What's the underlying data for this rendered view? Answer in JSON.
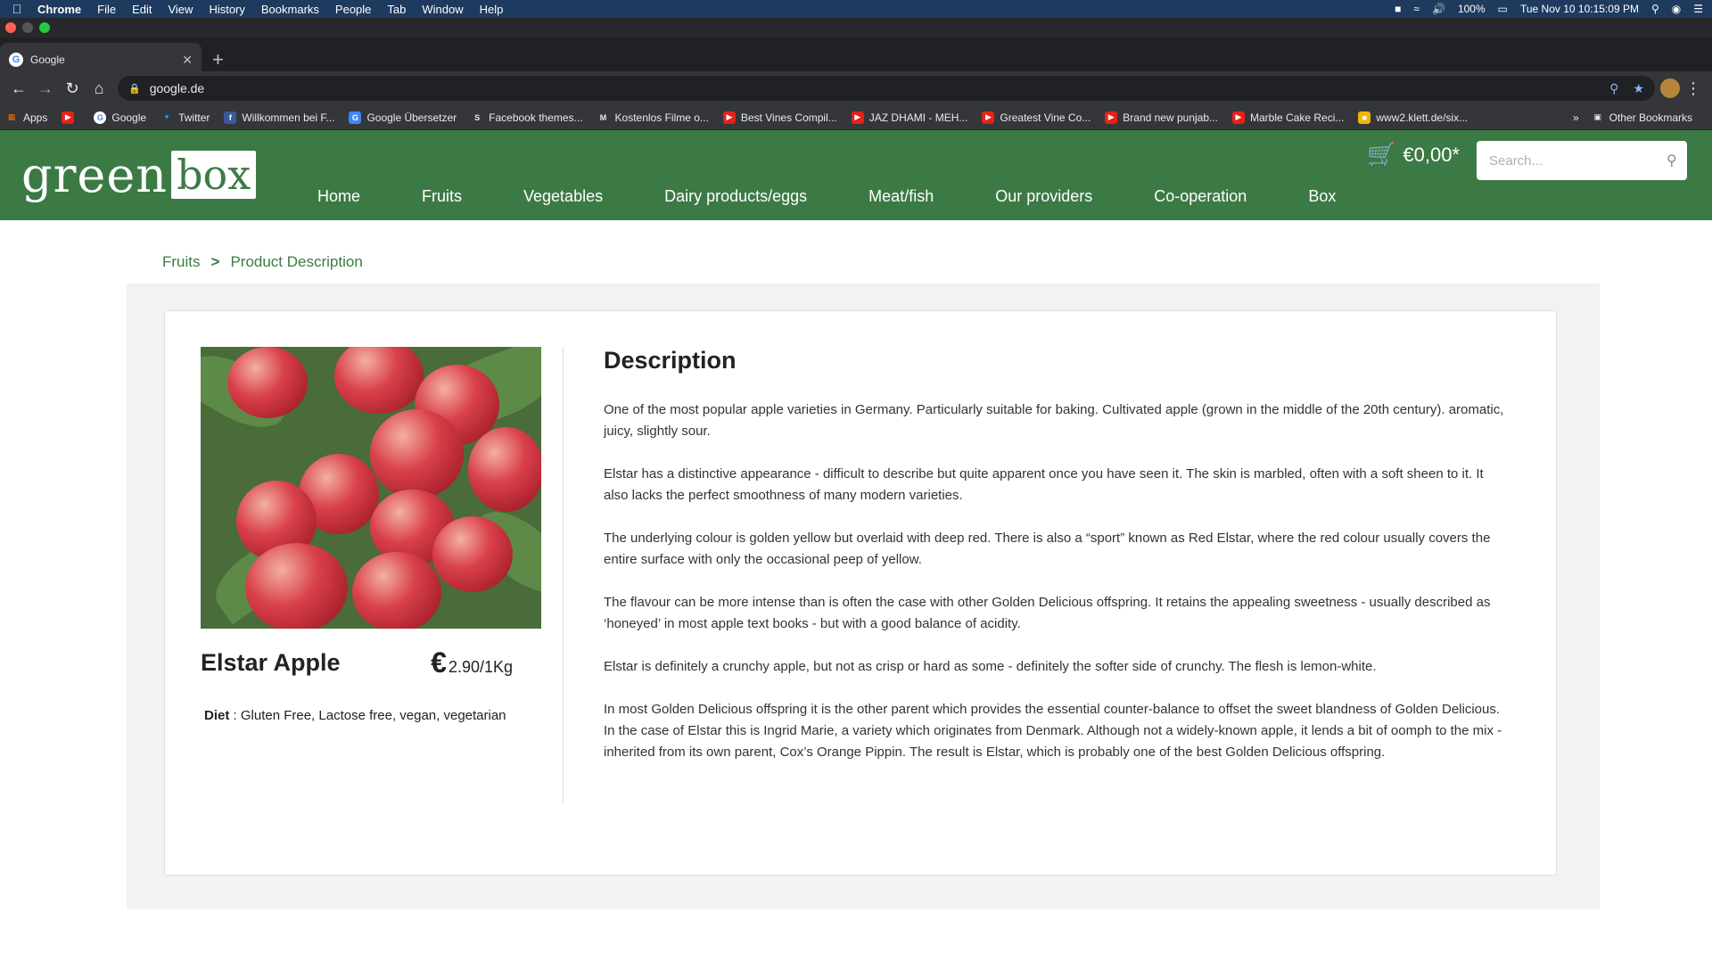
{
  "mac_menu": {
    "items": [
      "Chrome",
      "File",
      "Edit",
      "View",
      "History",
      "Bookmarks",
      "People",
      "Tab",
      "Window",
      "Help"
    ],
    "battery": "100%",
    "clock": "Tue Nov 10  10:15:09 PM"
  },
  "browser": {
    "tab_title": "Google",
    "url": "google.de",
    "bookmarks": [
      "Apps",
      "Google",
      "Twitter",
      "Willkommen bei F...",
      "Google Übersetzer",
      "Facebook themes...",
      "Kostenlos Filme o...",
      "Best Vines Compil...",
      "JAZ DHAMI - MEH...",
      "Greatest Vine Co...",
      "Brand new punjab...",
      "Marble Cake Reci...",
      "www2.klett.de/six..."
    ],
    "other_bookmarks": "Other Bookmarks",
    "overflow": "»"
  },
  "site": {
    "logo_green": "green",
    "logo_box": "box",
    "nav": [
      "Home",
      "Fruits",
      "Vegetables",
      "Dairy products/eggs",
      "Meat/fish",
      "Our providers",
      "Co-operation",
      "Box"
    ],
    "cart_total": "€0,00*",
    "search_placeholder": "Search..."
  },
  "breadcrumb": {
    "parent": "Fruits",
    "separator": ">",
    "current": "Product Description"
  },
  "product": {
    "name": "Elstar Apple",
    "currency": "€",
    "price": "2.90/1Kg",
    "diet_label": "Diet",
    "diet_value": ": Gluten Free, Lactose free, vegan, vegetarian"
  },
  "description": {
    "title": "Description",
    "paragraphs": [
      "One of the most popular apple varieties in Germany. Particularly suitable for baking. Cultivated apple (grown in the middle of the 20th century). aromatic, juicy, slightly sour.",
      "Elstar has a distinctive appearance - difficult to describe but quite apparent once you have seen it. The skin is marbled, often with a soft sheen to it. It also lacks the perfect smoothness of many modern varieties.",
      "The underlying colour is golden yellow but overlaid with deep red. There is also a “sport” known as Red Elstar, where the red colour usually covers the entire surface with only the occasional peep of yellow.",
      "The flavour can be more intense than is often the case with other Golden Delicious offspring.  It retains the appealing sweetness - usually described as ‘honeyed’ in most apple text books - but with a good balance of acidity.",
      "Elstar is definitely a crunchy apple, but not as crisp or hard as some - definitely the softer side of crunchy. The flesh is lemon-white.",
      "In most Golden Delicious offspring it is the other parent which provides the essential counter-balance to offset the sweet blandness of Golden Delicious. In the case of Elstar this is Ingrid Marie, a variety which originates from Denmark. Although not a widely-known apple, it lends a bit of oomph to the mix - inherited from its own parent, Cox’s Orange Pippin. The result is Elstar, which is probably one of the best Golden Delicious offspring."
    ]
  },
  "colors": {
    "brand_green": "#3c7a45",
    "menu_bar": "#1e3a5f"
  }
}
